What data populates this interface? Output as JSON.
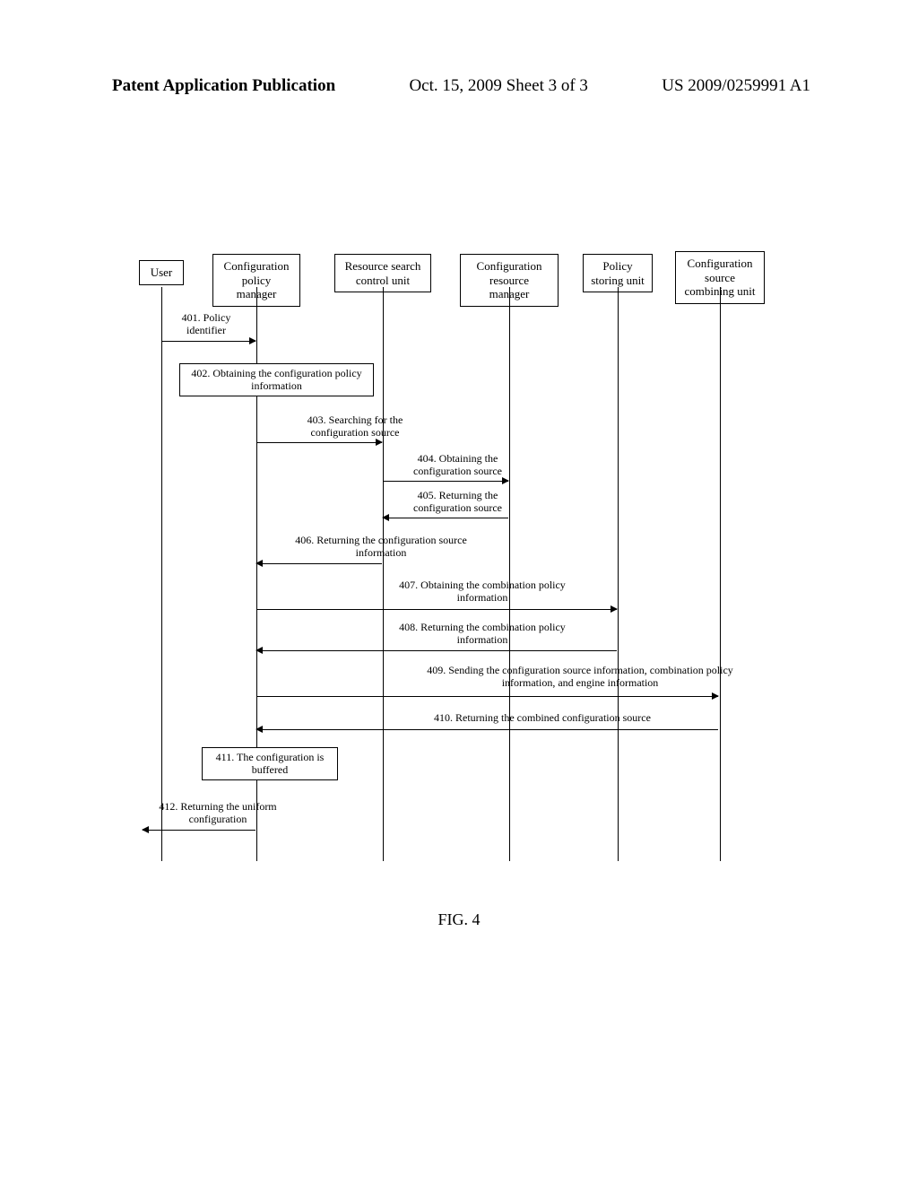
{
  "header": {
    "left": "Patent Application Publication",
    "center": "Oct. 15, 2009  Sheet 3 of 3",
    "right": "US 2009/0259991 A1"
  },
  "actors": {
    "user": "User",
    "config_policy_manager": "Configuration policy manager",
    "resource_search_control": "Resource search control unit",
    "config_resource_manager": "Configuration resource manager",
    "policy_storing": "Policy storing unit",
    "config_source_combining": "Configuration source combining unit"
  },
  "messages": {
    "m401": "401.  Policy identifier",
    "m402": "402. Obtaining the configuration policy information",
    "m403": "403. Searching for the configuration source",
    "m404": "404. Obtaining the configuration source",
    "m405": "405. Returning the configuration source",
    "m406": "406. Returning the configuration source information",
    "m407": "407. Obtaining the combination policy information",
    "m408": "408. Returning the combination policy information",
    "m409": "409. Sending the configuration source information, combination policy information, and engine information",
    "m410": "410. Returning the combined configuration source",
    "m411": "411. The configuration is buffered",
    "m412": "412. Returning the uniform configuration"
  },
  "figure_label": "FIG. 4"
}
